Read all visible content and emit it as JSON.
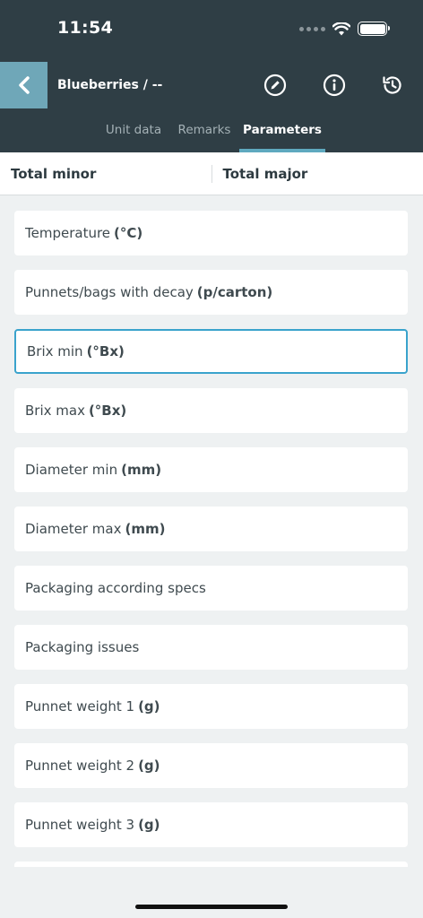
{
  "status": {
    "time": "11:54"
  },
  "header": {
    "title": "Blueberries / --",
    "icons": [
      "back-chevron-icon",
      "edit-icon",
      "info-icon",
      "history-icon"
    ]
  },
  "tabs": [
    {
      "label": "Unit data",
      "active": false
    },
    {
      "label": "Remarks",
      "active": false
    },
    {
      "label": "Parameters",
      "active": true
    }
  ],
  "totals": {
    "minor_label": "Total minor",
    "major_label": "Total major"
  },
  "fields": [
    {
      "label": "Temperature",
      "unit": "(°C)"
    },
    {
      "label": "Punnets/bags with decay",
      "unit": "(p/carton)"
    },
    {
      "label": "Brix min",
      "unit": "(°Bx)",
      "focused": true
    },
    {
      "label": "Brix max",
      "unit": "(°Bx)"
    },
    {
      "label": "Diameter min",
      "unit": "(mm)"
    },
    {
      "label": "Diameter max",
      "unit": "(mm)"
    },
    {
      "label": "Packaging according specs",
      "unit": ""
    },
    {
      "label": "Packaging issues",
      "unit": ""
    },
    {
      "label": "Punnet weight 1",
      "unit": "(g)"
    },
    {
      "label": "Punnet weight 2",
      "unit": "(g)"
    },
    {
      "label": "Punnet weight 3",
      "unit": "(g)"
    }
  ],
  "colors": {
    "header_bg": "#2f3e45",
    "accent": "#5fa9bf",
    "back_button": "#6fa7b8",
    "focus_border": "#3aa3cc"
  }
}
